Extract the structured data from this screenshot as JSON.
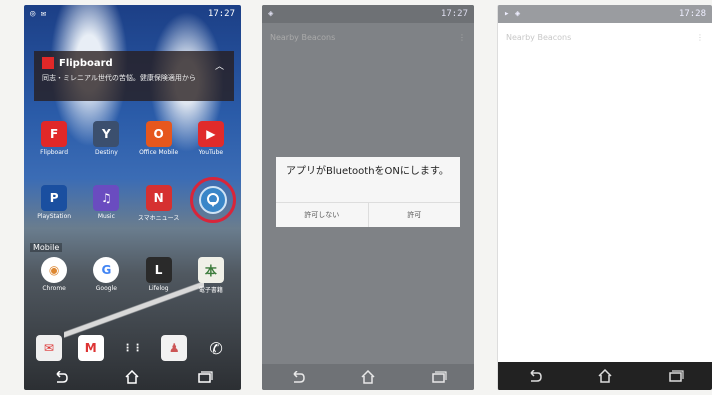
{
  "phone1": {
    "status_time": "17:27",
    "flipboard": {
      "title": "Flipboard",
      "message": "同志・ミレニアル世代の苦悩。健康保険適用から"
    },
    "row1": [
      {
        "label": "Flipboard",
        "color": "#e12828",
        "glyph": "F"
      },
      {
        "label": "Destiny",
        "color": "#3b4f6e",
        "glyph": "Y"
      },
      {
        "label": "Office Mobile",
        "color": "#e6571e",
        "glyph": "O"
      },
      {
        "label": "YouTube",
        "color": "#e02b2b",
        "glyph": "▶"
      }
    ],
    "row2": [
      {
        "label": "PlayStation",
        "color": "#1a4fa0",
        "glyph": "P"
      },
      {
        "label": "Music",
        "color": "#6a4cc0",
        "glyph": "♫"
      },
      {
        "label": "スマホニュース",
        "color": "#d63030",
        "glyph": "N"
      },
      {
        "label": "",
        "color": "transparent",
        "glyph": ""
      }
    ],
    "mobile_label": "Mobile",
    "row3": [
      {
        "label": "Chrome",
        "color": "#ffffff",
        "glyph": "◉"
      },
      {
        "label": "Google",
        "color": "#ffffff",
        "glyph": "G"
      },
      {
        "label": "Lifelog",
        "color": "#2a2a2a",
        "glyph": "L"
      },
      {
        "label": "電子書籍",
        "color": "#f0f0e8",
        "glyph": "本"
      }
    ],
    "dock": [
      {
        "label": "",
        "color": "#f0f0f0",
        "glyph": "✉"
      },
      {
        "label": "",
        "color": "#ffffff",
        "glyph": "M"
      },
      {
        "label": "",
        "color": "transparent",
        "glyph": "⋮⋮"
      },
      {
        "label": "",
        "color": "#f2f2f2",
        "glyph": "♟"
      },
      {
        "label": "",
        "color": "transparent",
        "glyph": "✆"
      }
    ],
    "highlight_color": "#d8253a"
  },
  "phone2": {
    "status_time": "17:27",
    "app_title": "Nearby Beacons",
    "dialog": {
      "message": "アプリがBluetoothをONにします。",
      "deny": "許可しない",
      "allow": "許可"
    }
  },
  "phone3": {
    "status_time": "17:28",
    "app_title": "Nearby Beacons"
  }
}
